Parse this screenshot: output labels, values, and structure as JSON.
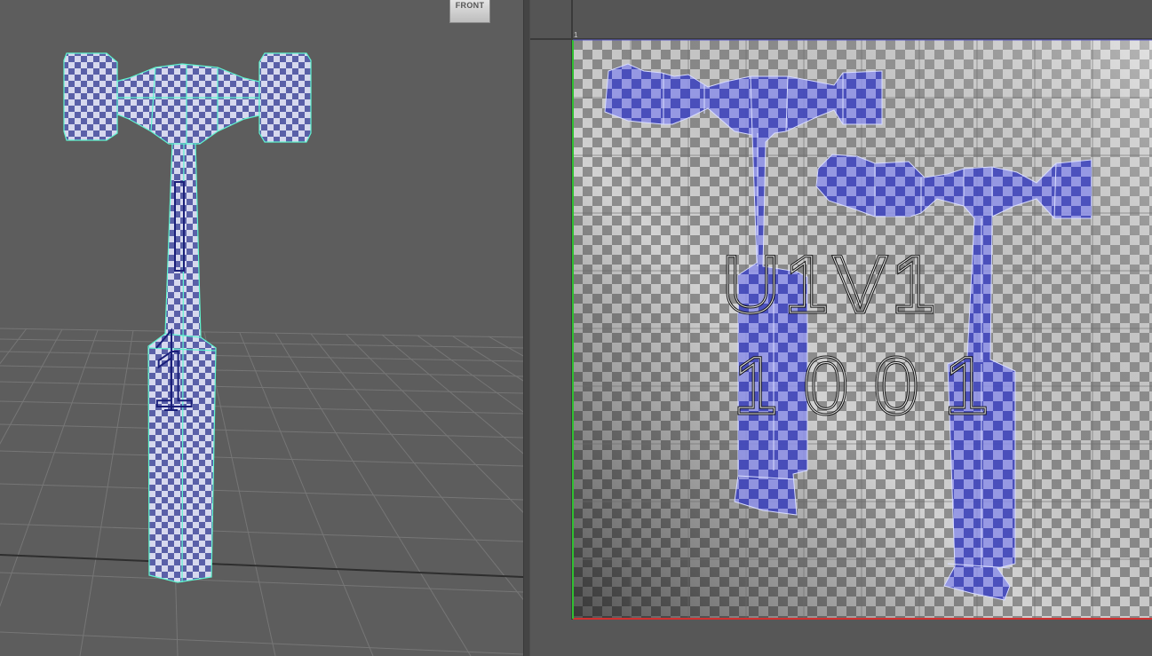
{
  "viewport": {
    "view_cube_label": "FRONT",
    "model_label_1": "1",
    "model_label_2": "1"
  },
  "uv_editor": {
    "tile_label_uv": "U1V1",
    "tile_label_udim": "1001",
    "corner_label": "1"
  },
  "colors": {
    "viewport_bg": "#5d5d5d",
    "uv_shell_fill": "#3a3fd0",
    "wireframe_highlight": "#5ff5d0",
    "u_axis": "#d03030",
    "v_axis": "#30c030"
  }
}
